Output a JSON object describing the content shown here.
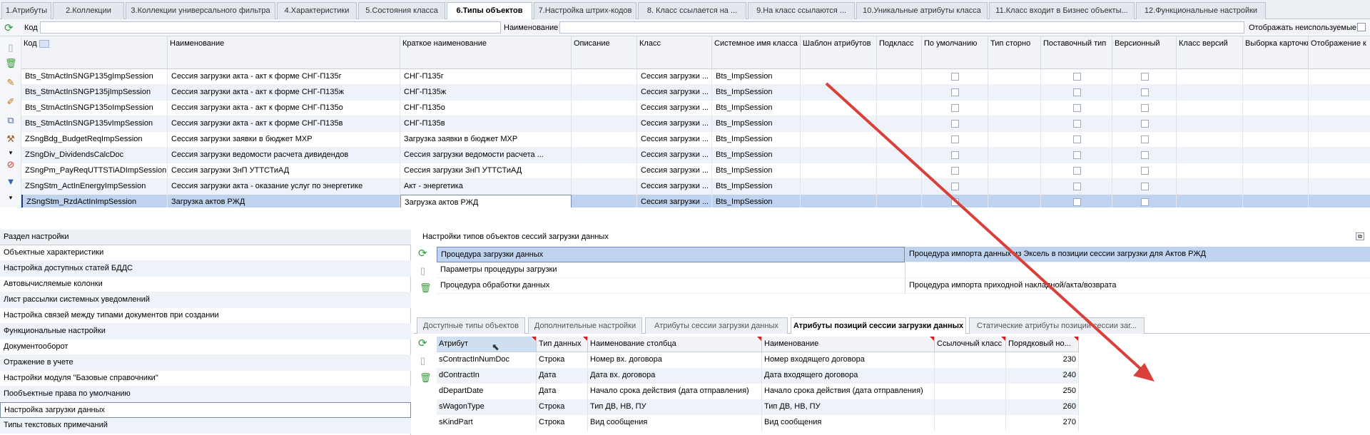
{
  "tabs": [
    "1.Атрибуты",
    "2.Коллекции",
    "3.Коллекции универсального фильтра",
    "4.Характеристики",
    "5.Состояния класса",
    "6.Типы объектов",
    "7.Настройка штрих-кодов",
    "8. Класс ссылается на ...",
    "9.На класс ссылаются ...",
    "10.Уникальные атрибуты класса",
    "11.Класс входит в Бизнес объекты...",
    "12.Функциональные настройки"
  ],
  "filter": {
    "code_label": "Код",
    "code_value": "",
    "name_label": "Наименование",
    "name_value": "",
    "show_unused_label": "Отображать неиспользуемые"
  },
  "columns": [
    "Код",
    "Наименование",
    "Краткое наименование",
    "Описание",
    "Класс",
    "Системное имя класса",
    "Шаблон атрибутов",
    "Подкласс",
    "По умолчанию",
    "Тип сторно",
    "Поставочный тип",
    "Версионный",
    "Класс версий",
    "Выборка карточки",
    "Отображение к"
  ],
  "rows": [
    {
      "code": "Bts_StmActInSNGP135gImpSession",
      "name": "Сессия загрузки акта - акт к форме СНГ-П135г",
      "short": "СНГ-П135г",
      "desc": "",
      "cls": "Сессия загрузки ...",
      "sys": "Bts_ImpSession"
    },
    {
      "code": "Bts_StmActInSNGP135jImpSession",
      "name": "Сессия загрузки акта - акт к форме СНГ-П135ж",
      "short": "СНГ-П135ж",
      "desc": "",
      "cls": "Сессия загрузки ...",
      "sys": "Bts_ImpSession"
    },
    {
      "code": "Bts_StmActInSNGP135oImpSession",
      "name": "Сессия загрузки акта - акт к форме СНГ-П135о",
      "short": "СНГ-П135о",
      "desc": "",
      "cls": "Сессия загрузки ...",
      "sys": "Bts_ImpSession"
    },
    {
      "code": "Bts_StmActInSNGP135vImpSession",
      "name": "Сессия загрузки акта - акт к форме СНГ-П135в",
      "short": "СНГ-П135в",
      "desc": "",
      "cls": "Сессия загрузки ...",
      "sys": "Bts_ImpSession"
    },
    {
      "code": "ZSngBdg_BudgetReqImpSession",
      "name": "Сессия загрузки заявки в бюджет МХР",
      "short": "Загрузка заявки в бюджет МХР",
      "desc": "",
      "cls": "Сессия загрузки ...",
      "sys": "Bts_ImpSession"
    },
    {
      "code": "ZSngDiv_DividendsCalcDoc",
      "name": "Сессия загрузки ведомости расчета дивидендов",
      "short": "Сессия загрузки ведомости расчета ...",
      "desc": "",
      "cls": "Сессия загрузки ...",
      "sys": "Bts_ImpSession"
    },
    {
      "code": "ZSngPm_PayReqUTTSTiADImpSession",
      "name": "Сессия загрузки ЗнП УТТСТиАД",
      "short": "Сессия загрузки ЗнП УТТСТиАД",
      "desc": "",
      "cls": "Сессия загрузки ...",
      "sys": "Bts_ImpSession"
    },
    {
      "code": "ZSngStm_ActInEnergyImpSession",
      "name": "Сессия загрузки акта - оказание услуг по энергетике",
      "short": "Акт - энергетика",
      "desc": "",
      "cls": "Сессия загрузки ...",
      "sys": "Bts_ImpSession"
    },
    {
      "code": "ZSngStm_RzdActInImpSession",
      "name": "Загрузка актов РЖД",
      "short": "Загрузка актов РЖД",
      "desc": "",
      "cls": "Сессия загрузки ...",
      "sys": "Bts_ImpSession"
    }
  ],
  "settings_header": "Раздел настройки",
  "settings": [
    "Объектные характеристики",
    "Настройка доступных статей БДДС",
    "Автовычисляемые колонки",
    "Лист рассылки системных уведомлений",
    "Настройка связей между типами документов при создании",
    "Функциональные настройки",
    "Документооборот",
    "Отражение в учете",
    "Настройки модуля \"Базовые справочники\"",
    "Пообъектные права по умолчанию",
    "Настройка загрузки данных",
    "Типы текстовых примечаний"
  ],
  "right_title": "Настройки типов объектов сессий загрузки данных",
  "procedures": [
    {
      "name": "Процедура загрузки данных",
      "value": "Процедура импорта данных из Эксель в позиции сессии загрузки для Актов РЖД"
    },
    {
      "name": "Параметры процедуры загрузки",
      "value": ""
    },
    {
      "name": "Процедура обработки данных",
      "value": "Процедура импорта приходной накладной/акта/возврата"
    }
  ],
  "inner_tabs": [
    "Доступные типы объектов",
    "Дополнительные настройки",
    "Атрибуты сессии загрузки данных",
    "Атрибуты позиций сессии загрузки данных",
    "Статические атрибуты позиций сессии заг..."
  ],
  "attr_columns": [
    "Атрибут",
    "Тип данных",
    "Наименование столбца",
    "Наименование",
    "Ссылочный класс",
    "Порядковый но..."
  ],
  "attrs": [
    {
      "attr": "sContractInNumDoc",
      "type": "Строка",
      "col": "Номер вх. договора",
      "name": "Номер входящего договора",
      "ref": "",
      "order": "230"
    },
    {
      "attr": "dContractIn",
      "type": "Дата",
      "col": "Дата вх. договора",
      "name": "Дата входящего договора",
      "ref": "",
      "order": "240"
    },
    {
      "attr": "dDepartDate",
      "type": "Дата",
      "col": "Начало срока действия (дата отправления)",
      "name": "Начало срока действия (дата отправления)",
      "ref": "",
      "order": "250"
    },
    {
      "attr": "sWagonType",
      "type": "Строка",
      "col": "Тип ДВ, НВ, ПУ",
      "name": "Тип ДВ, НВ, ПУ",
      "ref": "",
      "order": "260"
    },
    {
      "attr": "sKindPart",
      "type": "Строка",
      "col": "Вид сообщения",
      "name": "Вид сообщения",
      "ref": "",
      "order": "270"
    }
  ],
  "colors": {
    "accent": "#bfd3ee",
    "arrow": "#d9403c",
    "corner_mark": "#d21f1f"
  },
  "icons": [
    "refresh-icon",
    "new-icon",
    "delete-icon",
    "edit-icon",
    "edit-alt-icon",
    "copy-icon",
    "tools-icon",
    "block-icon",
    "filter-icon"
  ]
}
